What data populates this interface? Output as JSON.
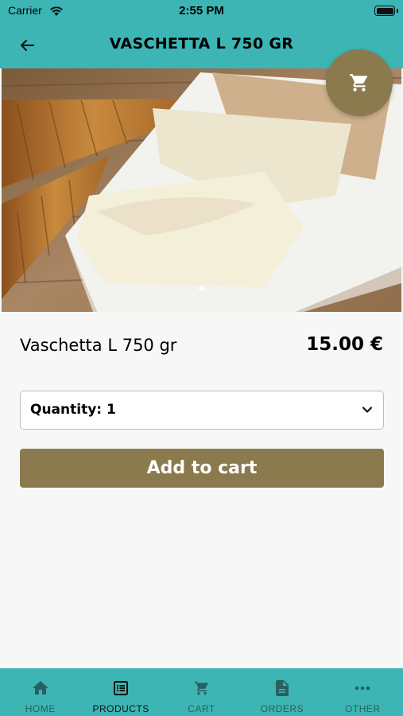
{
  "status_bar": {
    "carrier": "Carrier",
    "time": "2:55 PM"
  },
  "nav": {
    "title": "VASCHETTA L 750 GR",
    "back_icon": "arrow-left-icon"
  },
  "cart_fab": {
    "icon": "cart-icon"
  },
  "product": {
    "name": "Vaschetta L 750 gr",
    "price": "15.00 €"
  },
  "quantity_select": {
    "label": "Quantity: 1"
  },
  "add_to_cart": {
    "label": "Add to cart"
  },
  "tabs": [
    {
      "label": "HOME",
      "icon": "home-icon",
      "active": false
    },
    {
      "label": "PRODUCTS",
      "icon": "list-icon",
      "active": true
    },
    {
      "label": "CART",
      "icon": "cart-icon",
      "active": false
    },
    {
      "label": "ORDERS",
      "icon": "document-icon",
      "active": false
    },
    {
      "label": "OTHER",
      "icon": "more-icon",
      "active": false
    }
  ],
  "colors": {
    "teal": "#3cb5b4",
    "brown": "#8a7a4e",
    "background": "#f7f7f7"
  }
}
